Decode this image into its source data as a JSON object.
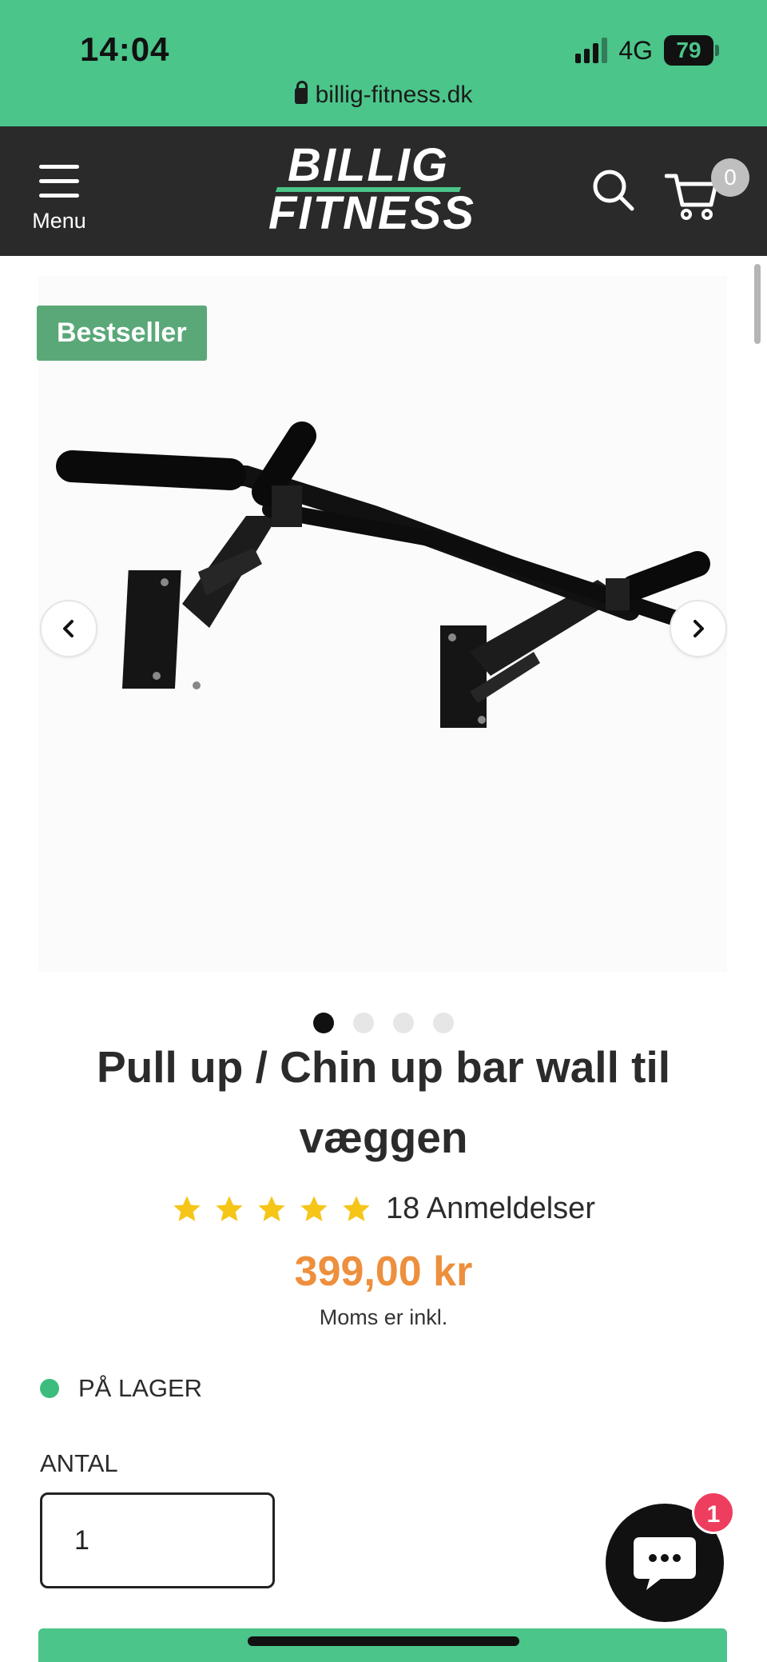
{
  "status_bar": {
    "time": "14:04",
    "network": "4G",
    "battery": "79"
  },
  "browser": {
    "url": "billig-fitness.dk"
  },
  "header": {
    "menu_label": "Menu",
    "logo_line1": "BILLIG",
    "logo_line2": "FITNESS",
    "cart_count": "0",
    "background": "#2a2a2a",
    "accent": "#4bc58a"
  },
  "gallery": {
    "badge": "Bestseller",
    "slide_count": 4,
    "active_slide": 1
  },
  "product": {
    "title": "Pull up / Chin up bar wall til væggen",
    "rating_stars": 5,
    "reviews": "18 Anmeldelser",
    "price": "399,00 kr",
    "price_color": "#ed8f3c",
    "tax_note": "Moms er inkl.",
    "stock_status": "PÅ LAGER",
    "quantity_label": "ANTAL",
    "quantity_value": "1"
  },
  "chat": {
    "unread": "1"
  }
}
